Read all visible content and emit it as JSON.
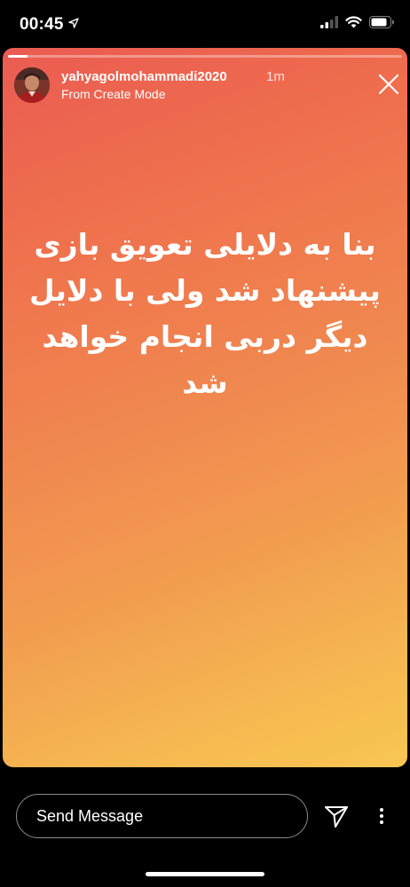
{
  "status_bar": {
    "time": "00:45",
    "location_icon": "location-arrow-icon",
    "signal_icon": "cellular-signal-icon",
    "wifi_icon": "wifi-icon",
    "battery_icon": "battery-icon"
  },
  "story": {
    "progress": 0.05,
    "username": "yahyagolmohammadi2020",
    "time_ago": "1m",
    "subtitle": "From Create Mode",
    "text_lines": [
      "بنا به دلایلی تعویق بازی",
      "پیشنهاد شد ولی با دلایل",
      "دیگر دربی انجام خواهد",
      "شد"
    ],
    "close_icon": "close-icon",
    "gradient_colors": [
      "#ea5b52",
      "#f0844f",
      "#f8c653"
    ]
  },
  "footer": {
    "message_placeholder": "Send Message",
    "send_icon": "paper-plane-icon",
    "more_icon": "more-options-icon"
  }
}
